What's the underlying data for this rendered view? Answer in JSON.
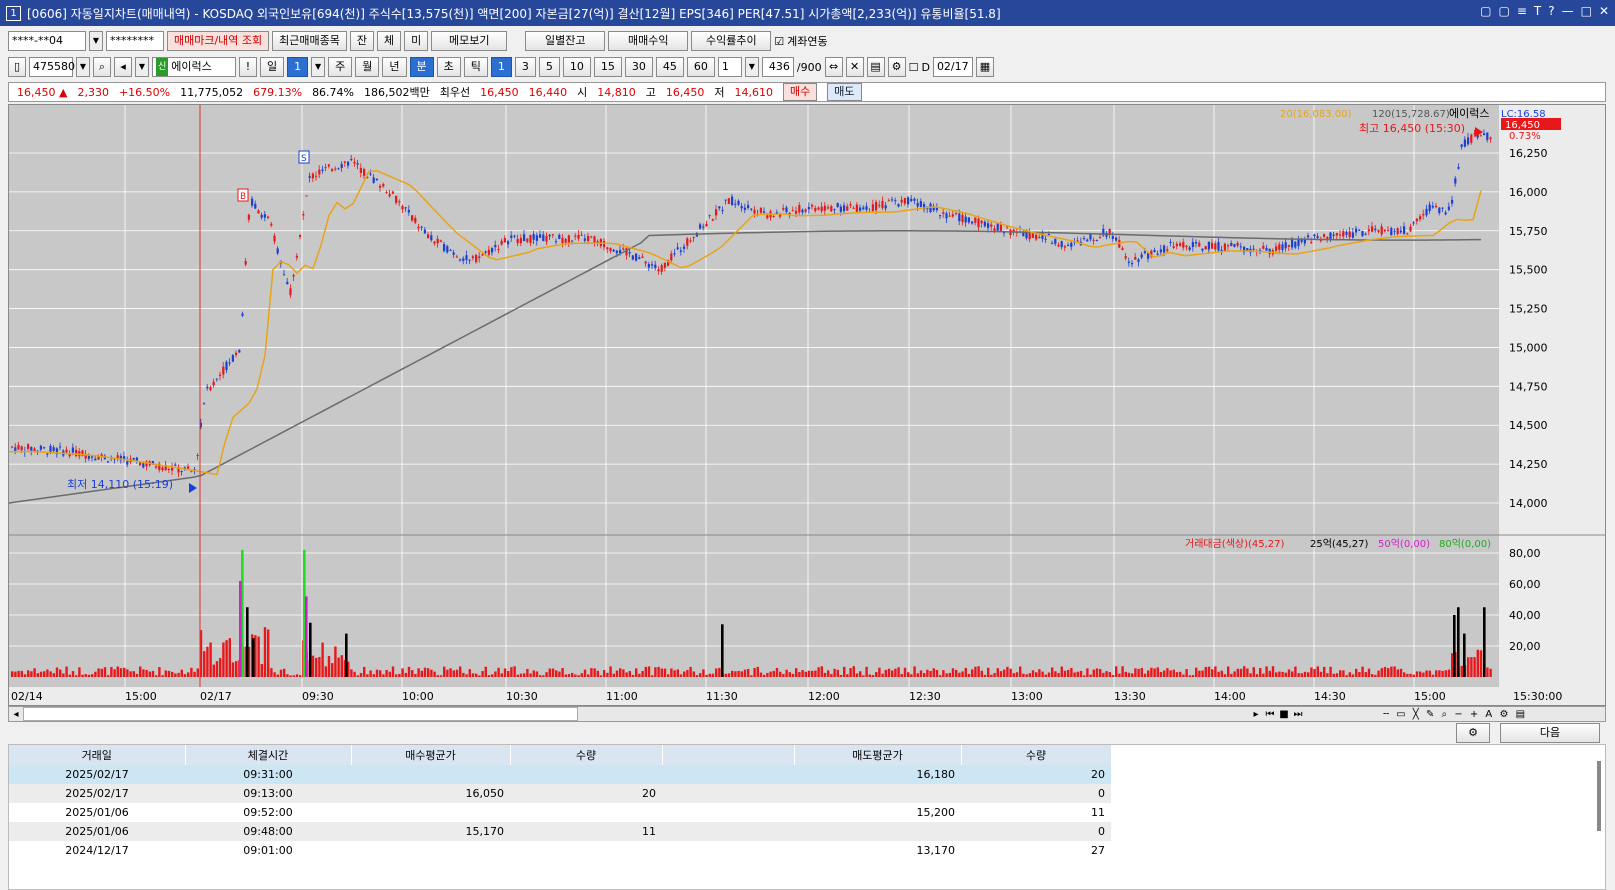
{
  "title": "[0606] 자동일지차트(매매내역) - KOSDAQ 외국인보유[694(천)] 주식수[13,575(천)] 액면[200] 자본금[27(억)] 결산[12월] EPS[346] PER[47.51] 시가총액[2,233(억)] 유통비율[51.8]",
  "app_icon": "1",
  "window_buttons": [
    "▢",
    "▢",
    "≡",
    "T",
    "?",
    "—",
    "□",
    "✕"
  ],
  "toolbar1": {
    "account": "****-**04",
    "password": "********",
    "btn_trade_mark": "매매마크/내역 조회",
    "btn_recent": "최근매매종목",
    "btn_jan": "잔",
    "btn_che": "체",
    "btn_mi": "미",
    "btn_memo": "메모보기",
    "btn_daily": "일별잔고",
    "btn_profit": "매매수익",
    "btn_return": "수익률추이",
    "account_link_label": "계좌연동"
  },
  "toolbar2": {
    "code": "475580",
    "name": "에이럭스",
    "icon_mark": "신",
    "exclaim": "!",
    "period_day": "일",
    "period_num": "1",
    "p_week": "주",
    "p_month": "월",
    "p_year": "년",
    "p_min": "분",
    "p_sec": "초",
    "p_tick": "틱",
    "mins": [
      "1",
      "3",
      "5",
      "10",
      "15",
      "30",
      "45",
      "60"
    ],
    "interval": "1",
    "count": "436",
    "count_total": "/900",
    "date_flag": "D",
    "date": "02/17"
  },
  "quote": {
    "price": "16,450 ▲",
    "change": "2,330",
    "change_rate": "+16.50%",
    "volume": "11,775,052",
    "vol_rate": "679.13%",
    "turnover": "86.74%",
    "amount": "186,502백만",
    "best_label": "최우선",
    "best_sell": "16,450",
    "best_buy": "16,440",
    "open_label": "시",
    "open": "14,810",
    "high_label": "고",
    "high": "16,450",
    "low_label": "저",
    "low": "14,610",
    "buy_btn": "매수",
    "sell_btn": "매도"
  },
  "chart": {
    "legend_ma20": "20(16,083.00)",
    "legend_ma120": "120(15,728.67)",
    "legend_name": "에이럭스",
    "lc_label": "LC:16.58",
    "cur_price_tag": "16,450",
    "cur_pct": "0.73%",
    "high_marker": "최고 16,450 (15:30)",
    "low_marker": "최저 14,110 (15:19)",
    "buy_mark": "B",
    "sell_mark": "S",
    "price_ticks": [
      "16,250",
      "16,000",
      "15,750",
      "15,500",
      "15,250",
      "15,000",
      "14,750",
      "14,500",
      "14,250",
      "14,000"
    ],
    "vol_legend": {
      "main": "거래대금(색상)(45,27)",
      "v25": "25억(45,27)",
      "v50": "50억(0,00)",
      "v80": "80억(0,00)"
    },
    "vol_ticks": [
      "80,00",
      "60,00",
      "40,00",
      "20,00"
    ],
    "time_ticks": [
      "02/14",
      "15:00",
      "02/17",
      "09:30",
      "10:00",
      "10:30",
      "11:00",
      "11:30",
      "12:00",
      "12:30",
      "13:00",
      "13:30",
      "14:00",
      "14:30",
      "15:00",
      "15:30:00"
    ],
    "colors": {
      "up": "#e8171a",
      "down": "#1a3fd4",
      "ma20": "#e8a417",
      "ma120": "#6b6b6b",
      "vol": "#e8171a",
      "vol25": "#000000",
      "vol50": "#d01fd0",
      "vol80": "#22dd22"
    }
  },
  "bottom": {
    "btn_next": "다음"
  },
  "chart_data": {
    "type": "candlestick",
    "title": "에이럭스",
    "ylim": [
      13950,
      16450
    ],
    "ma20_last": 16083.0,
    "ma120_last": 15728.67,
    "high": 16450,
    "low": 14110,
    "last": 16450
  },
  "grid": {
    "headers": [
      "거래일",
      "체결시간",
      "매수평균가",
      "수량",
      "",
      "매도평균가",
      "수량"
    ],
    "rows": [
      [
        "2025/02/17",
        "09:31:00",
        "",
        "",
        "",
        "16,180",
        "20"
      ],
      [
        "2025/02/17",
        "09:13:00",
        "16,050",
        "20",
        "",
        "",
        "0"
      ],
      [
        "2025/01/06",
        "09:52:00",
        "",
        "",
        "",
        "15,200",
        "11"
      ],
      [
        "2025/01/06",
        "09:48:00",
        "15,170",
        "11",
        "",
        "",
        "0"
      ],
      [
        "2024/12/17",
        "09:01:00",
        "",
        "",
        "",
        "13,170",
        "27"
      ]
    ]
  }
}
